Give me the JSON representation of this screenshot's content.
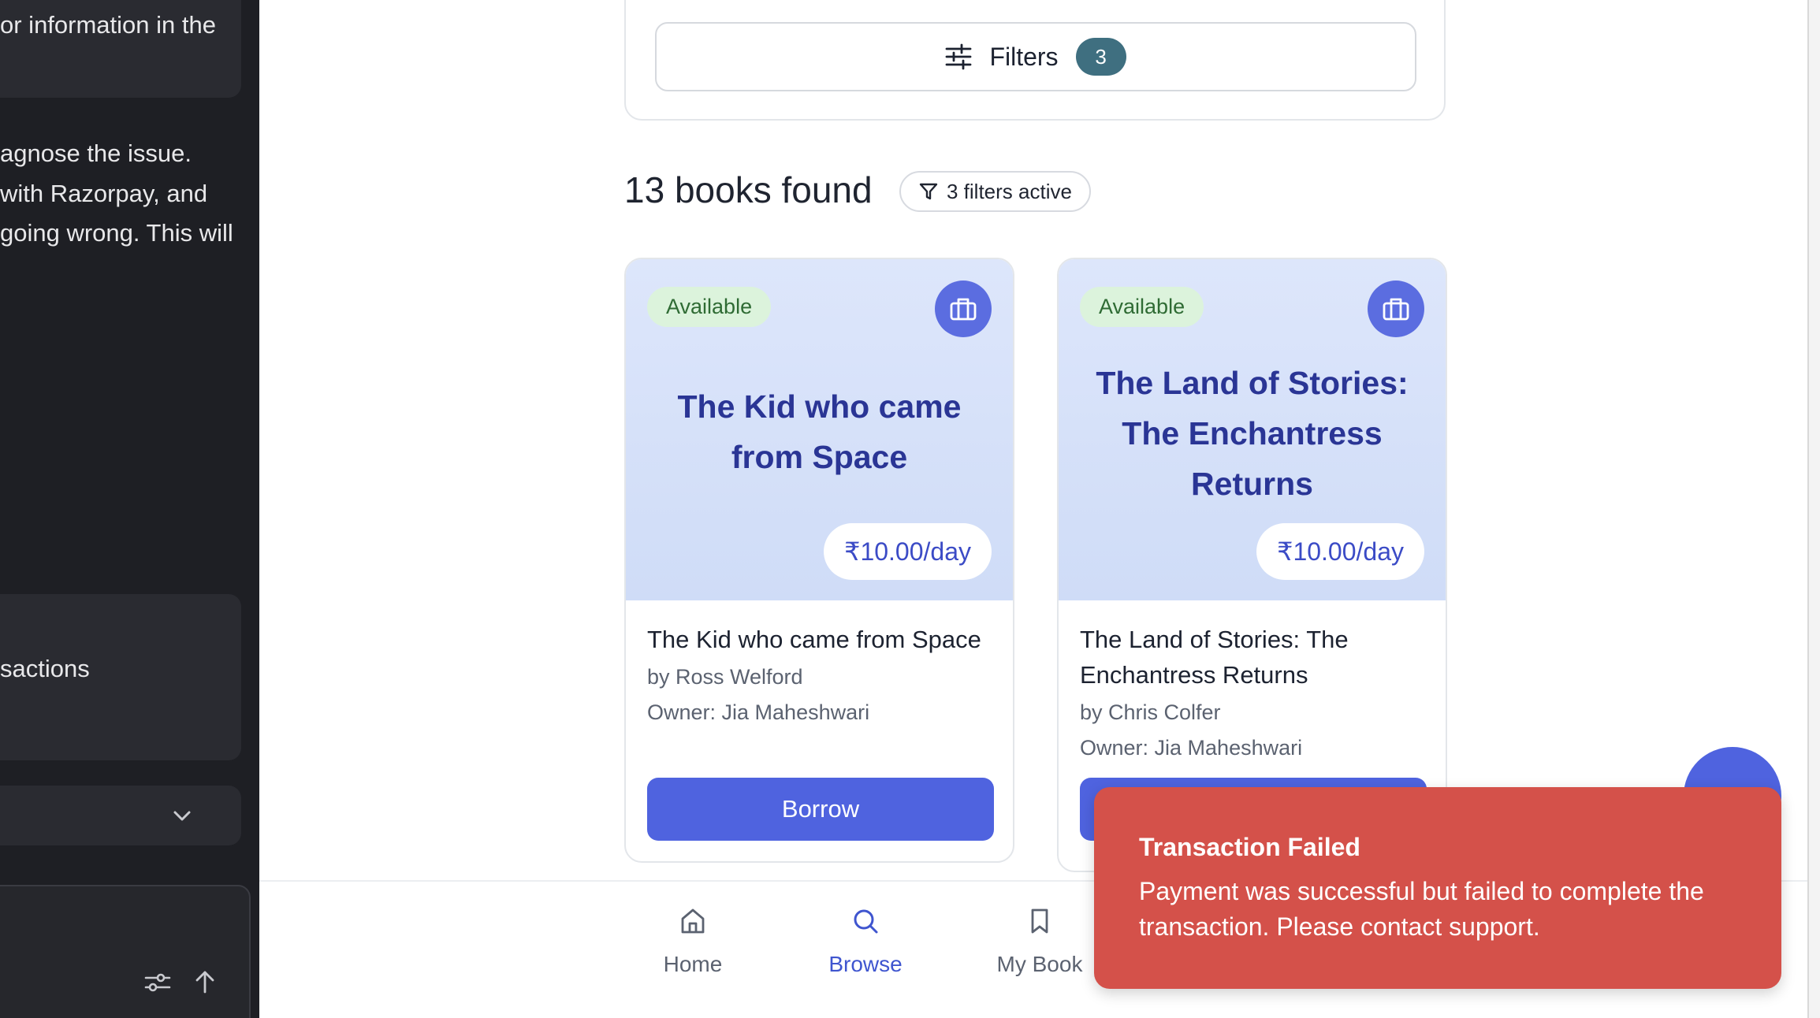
{
  "left_panel": {
    "snippet_1": "or information in the",
    "paragraph_lines": [
      "agnose the issue.",
      "with Razorpay, and",
      "going wrong. This will"
    ],
    "box_text": "sactions"
  },
  "filters": {
    "label": "Filters",
    "count": "3"
  },
  "results": {
    "title": "13 books found",
    "active_chip": "3 filters active"
  },
  "books": [
    {
      "status": "Available",
      "cover_title_lines": [
        "The Kid who came",
        "from Space"
      ],
      "price": "₹10.00/day",
      "title": "The Kid who came from Space",
      "author": "by Ross Welford",
      "owner": "Owner: Jia Maheshwari",
      "button": "Borrow"
    },
    {
      "status": "Available",
      "cover_title_lines": [
        "The Land of Stories:",
        "The Enchantress",
        "Returns"
      ],
      "price": "₹10.00/day",
      "title_lines": [
        "The Land of Stories: The",
        "Enchantress Returns"
      ],
      "author": "by Chris Colfer",
      "owner": "Owner: Jia Maheshwari"
    }
  ],
  "bottom_nav": [
    {
      "label": "Home",
      "icon": "home-icon",
      "active": false
    },
    {
      "label": "Browse",
      "icon": "search-icon",
      "active": true
    },
    {
      "label": "My Book",
      "icon": "bookmark-icon",
      "active": false
    }
  ],
  "toast": {
    "title": "Transaction Failed",
    "message": "Payment was successful but failed to complete the transaction. Please contact support."
  },
  "colors": {
    "accent": "#4f63df",
    "badge": "#3f6f80",
    "available_bg": "#dcf3dc",
    "available_text": "#2f6b34",
    "toast_bg": "#d4514a",
    "cover_title": "#2a3595"
  }
}
